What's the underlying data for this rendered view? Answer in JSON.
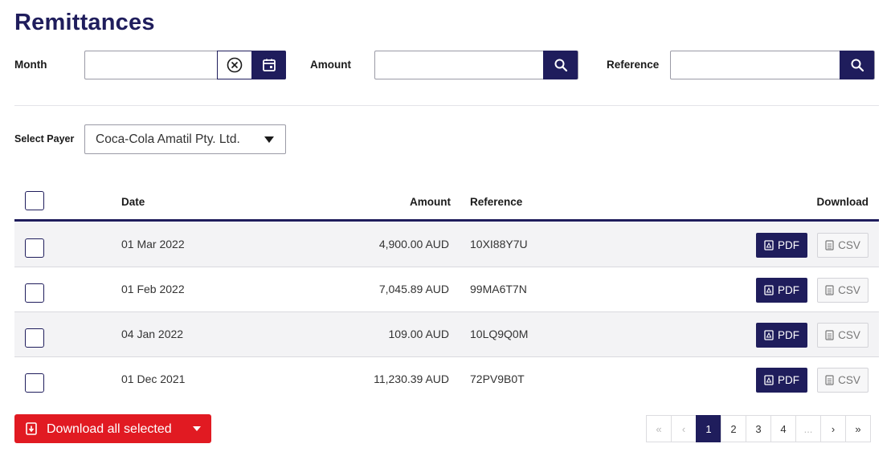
{
  "page": {
    "title": "Remittances"
  },
  "filters": {
    "month_label": "Month",
    "month_value": "",
    "amount_label": "Amount",
    "amount_value": "",
    "reference_label": "Reference",
    "reference_value": ""
  },
  "payer": {
    "label": "Select Payer",
    "selected": "Coca-Cola Amatil Pty. Ltd."
  },
  "table": {
    "headers": {
      "date": "Date",
      "amount": "Amount",
      "reference": "Reference",
      "download": "Download"
    },
    "rows": [
      {
        "date": "01 Mar 2022",
        "amount": "4,900.00 AUD",
        "reference": "10XI88Y7U"
      },
      {
        "date": "01 Feb 2022",
        "amount": "7,045.89 AUD",
        "reference": "99MA6T7N"
      },
      {
        "date": "04 Jan 2022",
        "amount": "109.00 AUD",
        "reference": "10LQ9Q0M"
      },
      {
        "date": "01 Dec 2021",
        "amount": "11,230.39 AUD",
        "reference": "72PV9B0T"
      }
    ],
    "pdf_label": "PDF",
    "csv_label": "CSV"
  },
  "actions": {
    "download_all": "Download all selected"
  },
  "pagination": {
    "first": "«",
    "prev": "‹",
    "pages": [
      "1",
      "2",
      "3",
      "4"
    ],
    "ellipsis": "...",
    "next": "›",
    "last": "»",
    "current": "1"
  },
  "colors": {
    "primary": "#1f1d5c",
    "danger": "#e11a22"
  }
}
